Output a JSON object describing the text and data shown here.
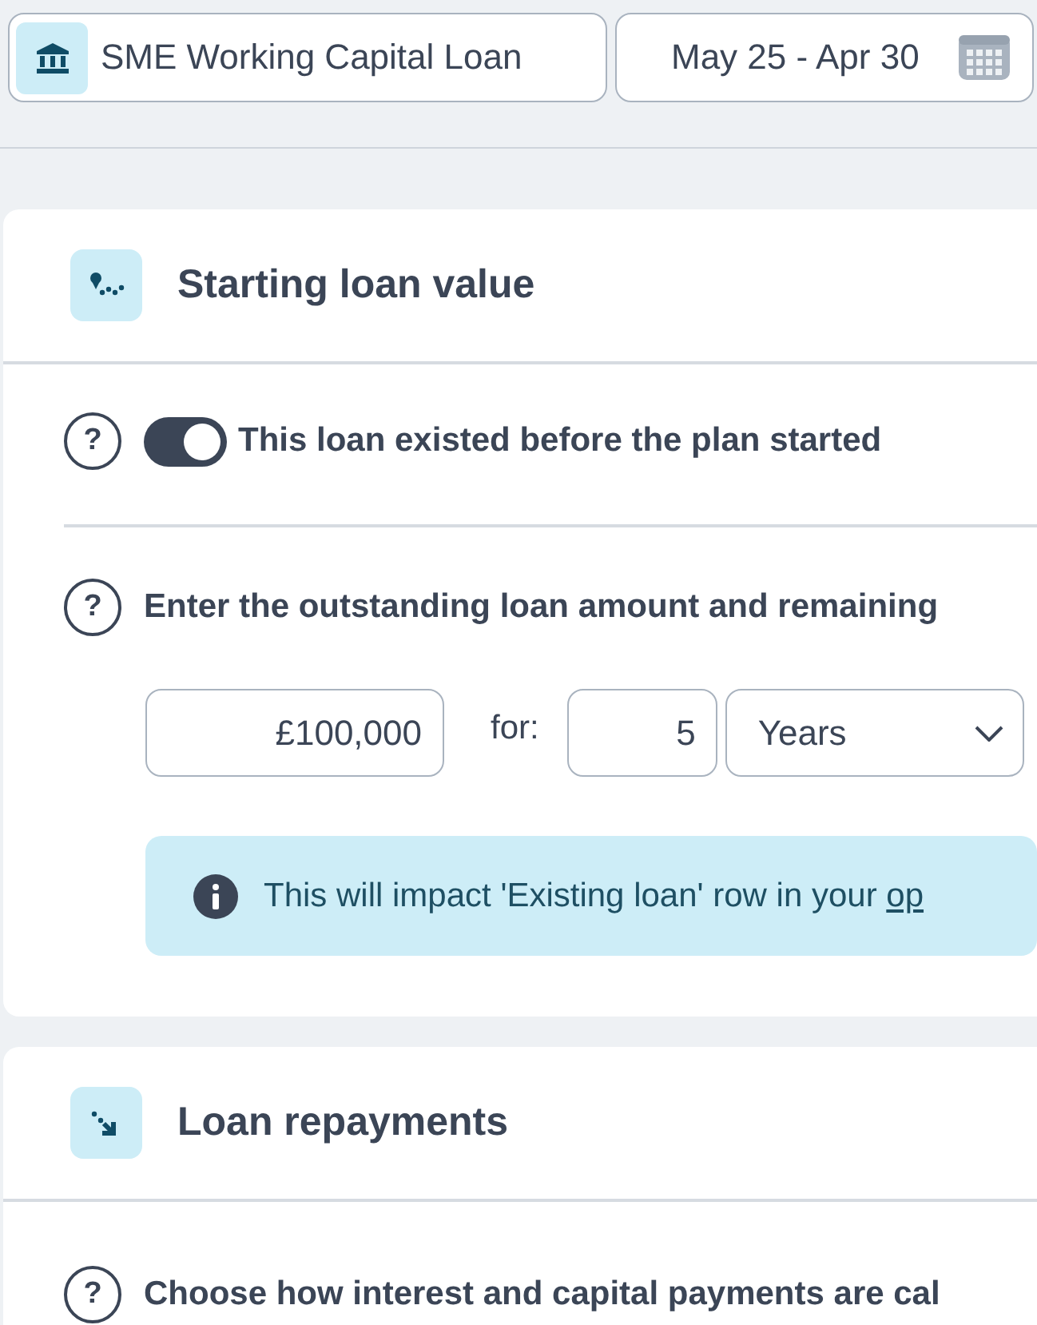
{
  "top_bar": {
    "plan": {
      "label": "SME Working Capital Loan"
    },
    "date_range": {
      "label": "May 25 - Apr 30"
    }
  },
  "sections": [
    {
      "kind": "starting",
      "title": "Starting loan value",
      "toggle": {
        "help": "?",
        "label": "This loan existed before the plan started",
        "on": true
      },
      "question_help": "?",
      "question": "Enter the outstanding loan amount and remaining",
      "amount": {
        "value": "£100,000"
      },
      "for_label": "for:",
      "term": {
        "value": "5"
      },
      "unit": {
        "value": "Years"
      },
      "info": {
        "text": "This will impact 'Existing loan' row in your ",
        "link": "op"
      }
    },
    {
      "kind": "repayments",
      "title": "Loan repayments",
      "question_help": "?",
      "question": "Choose how interest and capital payments are cal"
    }
  ]
}
